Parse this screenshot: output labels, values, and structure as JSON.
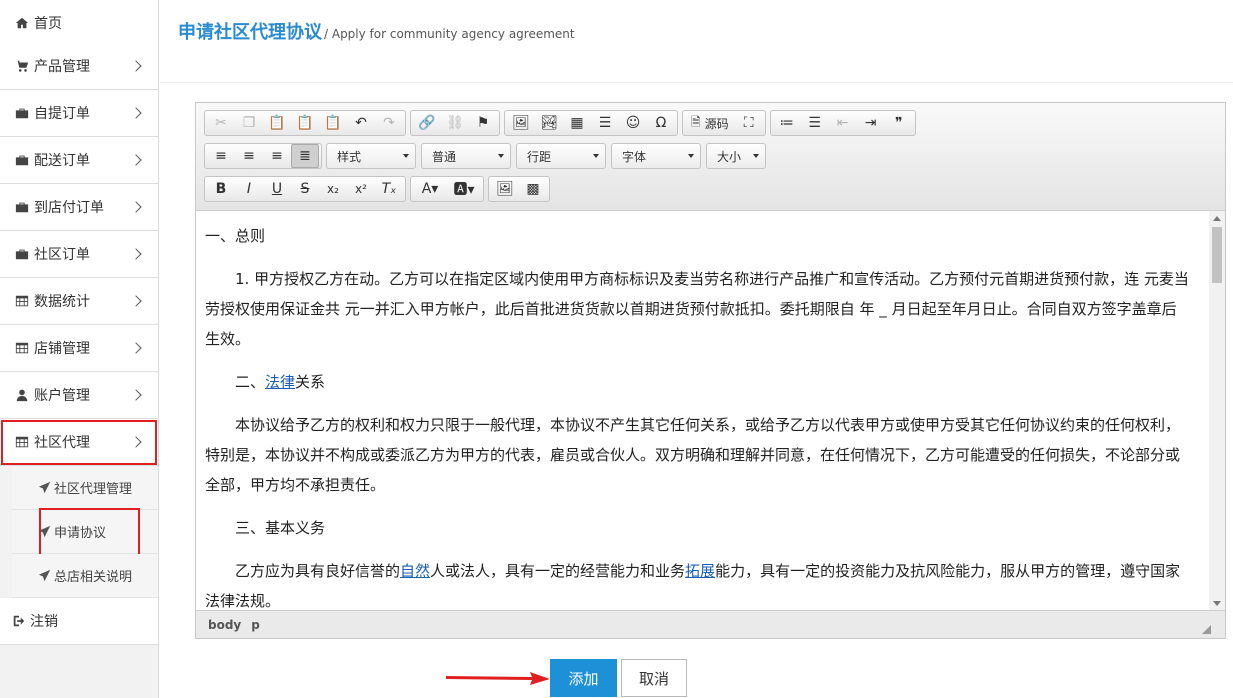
{
  "sidebar": {
    "items": [
      {
        "label": "首页",
        "icon": "home-icon"
      },
      {
        "label": "产品管理",
        "icon": "cart-icon"
      },
      {
        "label": "自提订单",
        "icon": "briefcase-icon"
      },
      {
        "label": "配送订单",
        "icon": "briefcase-icon"
      },
      {
        "label": "到店付订单",
        "icon": "briefcase-icon"
      },
      {
        "label": "社区订单",
        "icon": "briefcase-icon"
      },
      {
        "label": "数据统计",
        "icon": "table-icon"
      },
      {
        "label": "店铺管理",
        "icon": "table-icon"
      },
      {
        "label": "账户管理",
        "icon": "user-icon"
      },
      {
        "label": "社区代理",
        "icon": "table-icon"
      }
    ],
    "sub_items": [
      {
        "label": "社区代理管理",
        "icon": "send-icon"
      },
      {
        "label": "申请协议",
        "icon": "send-icon"
      },
      {
        "label": "总店相关说明",
        "icon": "send-icon"
      }
    ],
    "logout_label": "注销"
  },
  "header": {
    "title": "申请社区代理协议",
    "subtitle": "/ Apply for community agency agreement"
  },
  "editor": {
    "toolbar": {
      "source_label": "源码",
      "style_select": "样式",
      "format_select": "普通",
      "line_height_select": "行距",
      "font_select": "字体",
      "size_select": "大小"
    },
    "content": {
      "heading1": "一、总则",
      "para1": "1. 甲方授权乙方在动。乙方可以在指定区域内使用甲方商标标识及麦当劳名称进行产品推广和宣传活动。乙方预付元首期进货预付款，连 元麦当劳授权使用保证金共 元一并汇入甲方帐户，此后首批进货货款以首期进货预付款抵扣。委托期限自 年 _ 月日起至年月日止。合同自双方签字盖章后生效。",
      "heading2_prefix": "二、",
      "heading2_link": "法律",
      "heading2_suffix": "关系",
      "para2": "本协议给予乙方的权利和权力只限于一般代理，本协议不产生其它任何关系，或给予乙方以代表甲方或使甲方受其它任何协议约束的任何权利，特别是，本协议并不构成或委派乙方为甲方的代表，雇员或合伙人。双方明确和理解并同意，在任何情况下，乙方可能遭受的任何损失，不论部分或全部，甲方均不承担责任。",
      "heading3": "三、基本义务",
      "para3_a": "乙方应为具有良好信誉的",
      "para3_link1": "自然",
      "para3_b": "人或法人，具有一定的经营能力和业务",
      "para3_link2": "拓展",
      "para3_c": "能力，具有一定的投资能力及抗风险能力，服从甲方的管理，遵守国家法律法规。"
    },
    "statusbar": {
      "path1": "body",
      "path2": "p"
    }
  },
  "buttons": {
    "add": "添加",
    "cancel": "取消"
  },
  "colors": {
    "accent": "#1e90d8",
    "title": "#2a8bd2",
    "highlight": "#e02020"
  }
}
